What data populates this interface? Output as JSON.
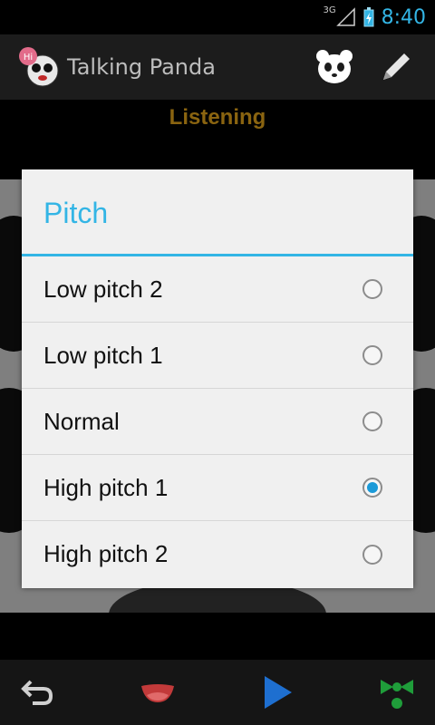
{
  "status_bar": {
    "network": "3G",
    "time": "8:40"
  },
  "action_bar": {
    "title": "Talking Panda",
    "logo_badge": "Hi"
  },
  "status_label": "Listening",
  "dialog": {
    "title": "Pitch",
    "options": [
      {
        "label": "Low pitch 2",
        "selected": false
      },
      {
        "label": "Low pitch 1",
        "selected": false
      },
      {
        "label": "Normal",
        "selected": false
      },
      {
        "label": "High pitch 1",
        "selected": true
      },
      {
        "label": "High pitch 2",
        "selected": false
      }
    ]
  },
  "colors": {
    "accent": "#33b5e5",
    "listening": "#8a6410",
    "radio_checked": "#1b9ad8"
  },
  "icons": {
    "panda": "panda-icon",
    "edit": "pencil-icon",
    "back": "undo-arrow-icon",
    "mouth": "mouth-icon",
    "play": "play-icon",
    "bow": "bow-tie-icon"
  }
}
